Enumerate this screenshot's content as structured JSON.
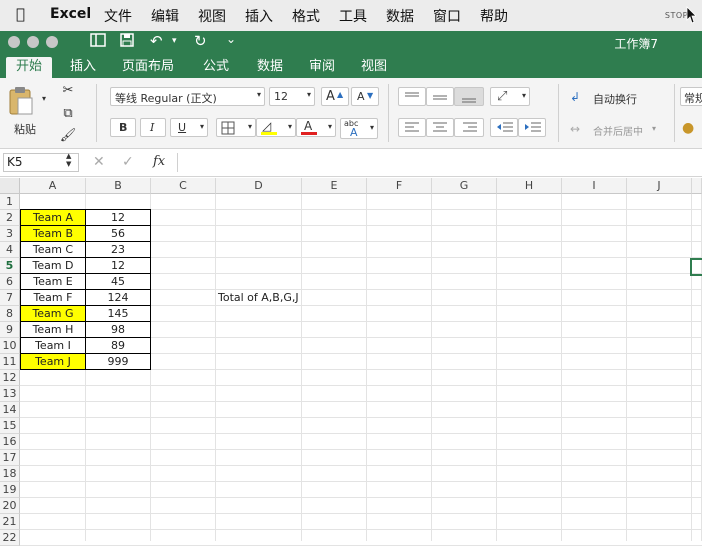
{
  "menubar": {
    "app": "Excel",
    "items": [
      "文件",
      "编辑",
      "视图",
      "插入",
      "格式",
      "工具",
      "数据",
      "窗口",
      "帮助"
    ],
    "status": "STOP"
  },
  "window": {
    "title": "工作簿7"
  },
  "tabs": [
    "开始",
    "插入",
    "页面布局",
    "公式",
    "数据",
    "审阅",
    "视图"
  ],
  "ribbon": {
    "paste_label": "粘贴",
    "font_name": "等线 Regular (正文)",
    "font_size": "12",
    "bold": "B",
    "italic": "I",
    "underline": "U",
    "wrap_text": "自动换行",
    "merge_center": "合并后居中",
    "number_format": "常规",
    "phonetic": "abc",
    "font_color_glyph": "A",
    "grow_font": "A",
    "shrink_font": "A"
  },
  "formula_bar": {
    "name_box": "K5",
    "fx": "fx",
    "value": ""
  },
  "columns": [
    "A",
    "B",
    "C",
    "D",
    "E",
    "F",
    "G",
    "H",
    "I",
    "J"
  ],
  "rows": [
    "1",
    "2",
    "3",
    "4",
    "5",
    "6",
    "7",
    "8",
    "9",
    "10",
    "11",
    "12",
    "13",
    "14",
    "15",
    "16",
    "17",
    "18",
    "19",
    "20",
    "21",
    "22"
  ],
  "selected_row": "5",
  "highlight_color": "#ffff00",
  "accent_color": "#2f7d4f",
  "table": [
    {
      "team": "Team A",
      "value": "12",
      "highlight": true
    },
    {
      "team": "Team B",
      "value": "56",
      "highlight": true
    },
    {
      "team": "Team C",
      "value": "23",
      "highlight": false
    },
    {
      "team": "Team D",
      "value": "12",
      "highlight": false
    },
    {
      "team": "Team E",
      "value": "45",
      "highlight": false
    },
    {
      "team": "Team F",
      "value": "124",
      "highlight": false
    },
    {
      "team": "Team G",
      "value": "145",
      "highlight": true
    },
    {
      "team": "Team H",
      "value": "98",
      "highlight": false
    },
    {
      "team": "Team I",
      "value": "89",
      "highlight": false
    },
    {
      "team": "Team J",
      "value": "999",
      "highlight": true
    }
  ],
  "note_cell": "Total of A,B,G,J"
}
